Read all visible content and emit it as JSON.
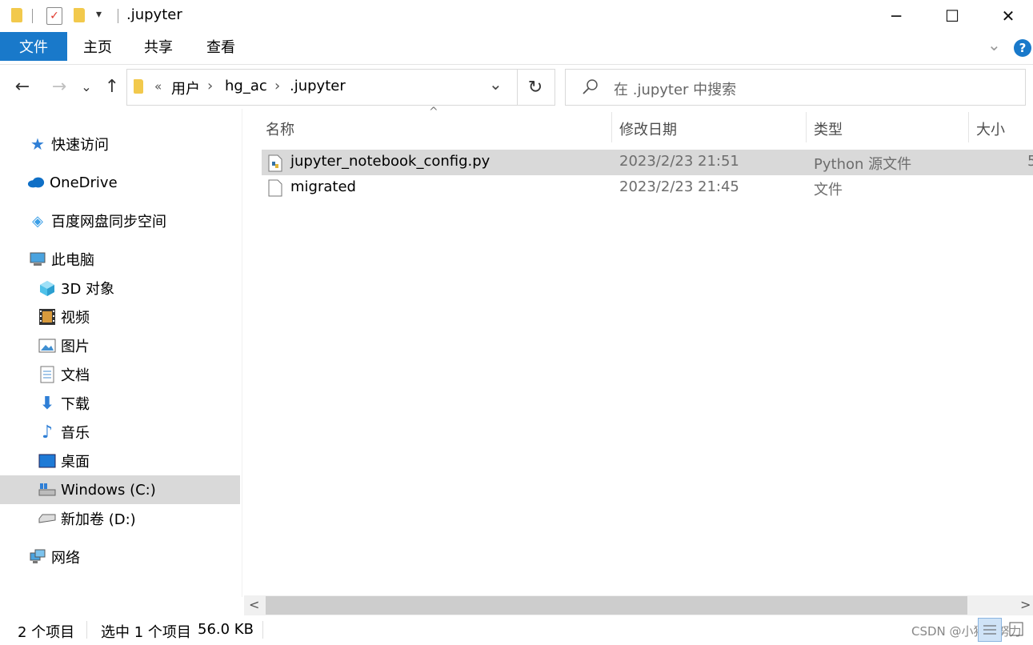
{
  "window": {
    "title": ".jupyter",
    "minimize_label": "─",
    "maximize_label": "☐",
    "close_label": "✕"
  },
  "ribbon": {
    "tabs": [
      "文件",
      "主页",
      "共享",
      "查看"
    ],
    "help_label": "?",
    "expand_label": "⌄"
  },
  "address": {
    "back_label": "←",
    "forward_label": "→",
    "recent_label": "⌄",
    "up_label": "↑",
    "overflow_label": "«",
    "crumbs": [
      "用户",
      "hg_ac",
      ".jupyter"
    ],
    "crumb_sep": "›",
    "dropdown_label": "⌄",
    "refresh_label": "↻"
  },
  "search": {
    "placeholder": "在 .jupyter 中搜索"
  },
  "nav": {
    "quick_access": "快速访问",
    "onedrive": "OneDrive",
    "baidu": "百度网盘同步空间",
    "this_pc": "此电脑",
    "items": [
      "3D 对象",
      "视频",
      "图片",
      "文档",
      "下载",
      "音乐",
      "桌面",
      "Windows (C:)",
      "新加卷 (D:)"
    ],
    "network": "网络"
  },
  "columns": {
    "name": "名称",
    "modified": "修改日期",
    "type": "类型",
    "size": "大小",
    "sort_indicator": "^"
  },
  "files": [
    {
      "name": "jupyter_notebook_config.py",
      "modified": "2023/2/23 21:51",
      "type": "Python 源文件",
      "size": "5",
      "selected": true,
      "icon": "python-file-icon"
    },
    {
      "name": "migrated",
      "modified": "2023/2/23 21:45",
      "type": "文件",
      "size": "",
      "selected": false,
      "icon": "file-icon"
    }
  ],
  "scroll": {
    "left_label": "<",
    "right_label": ">"
  },
  "status": {
    "count": "2 个项目",
    "selection": "选中 1 个项目",
    "size": "56.0 KB",
    "watermark": "CSDN @小猪在努力"
  },
  "colors": {
    "accent": "#1979ca",
    "selected_row": "#d9d9d9",
    "selected_nav": "#d9d9d9"
  }
}
